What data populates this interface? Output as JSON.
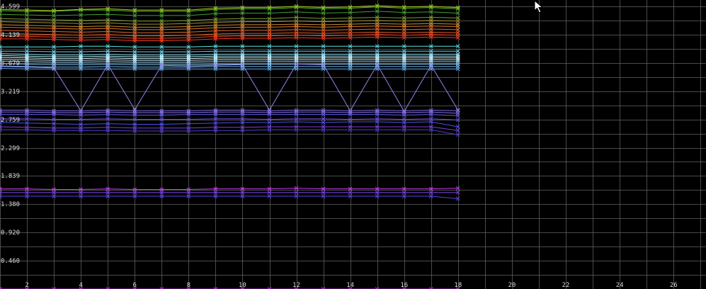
{
  "chart_data": {
    "type": "line",
    "title": "",
    "xlabel": "",
    "ylabel": "",
    "xlim": [
      1,
      27.1
    ],
    "ylim": [
      0,
      4.599
    ],
    "grid": true,
    "legend": "none",
    "background": "#000000",
    "grid_color": "#6a6a6a",
    "x_ticks": [
      2,
      4,
      6,
      8,
      10,
      12,
      14,
      16,
      18,
      20,
      22,
      24,
      26
    ],
    "x_tick_labels": [
      "2",
      "4",
      "6",
      "8",
      "10",
      "12",
      "14",
      "16",
      "18",
      "20",
      "22",
      "24",
      "26"
    ],
    "y_ticks": [
      0.46,
      0.92,
      1.38,
      1.839,
      2.299,
      2.759,
      3.219,
      3.679,
      4.139,
      4.599
    ],
    "y_tick_labels": [
      "0.460",
      "0.920",
      "1.380",
      "1.839",
      "2.299",
      "2.759",
      "3.219",
      "3.679",
      "4.139",
      "4.599"
    ],
    "x": [
      1,
      2,
      3,
      4,
      5,
      6,
      7,
      8,
      9,
      10,
      11,
      12,
      13,
      14,
      15,
      16,
      17,
      18
    ],
    "series": [
      {
        "color": "#a0c820",
        "values": [
          4.55,
          4.54,
          4.53,
          4.55,
          4.56,
          4.54,
          4.54,
          4.54,
          4.57,
          4.58,
          4.58,
          4.6,
          4.58,
          4.59,
          4.61,
          4.59,
          4.6,
          4.58
        ]
      },
      {
        "color": "#6ab820",
        "values": [
          4.53,
          4.52,
          4.52,
          4.54,
          4.54,
          4.52,
          4.52,
          4.52,
          4.55,
          4.56,
          4.56,
          4.58,
          4.56,
          4.57,
          4.59,
          4.57,
          4.58,
          4.56
        ]
      },
      {
        "color": "#40a030",
        "values": [
          4.47,
          4.46,
          4.45,
          4.46,
          4.47,
          4.45,
          4.45,
          4.45,
          4.48,
          4.49,
          4.49,
          4.51,
          4.49,
          4.5,
          4.52,
          4.5,
          4.51,
          4.49
        ]
      },
      {
        "color": "#7a9a30",
        "values": [
          4.4,
          4.39,
          4.38,
          4.37,
          4.38,
          4.36,
          4.36,
          4.37,
          4.39,
          4.4,
          4.4,
          4.42,
          4.4,
          4.41,
          4.42,
          4.41,
          4.42,
          4.41
        ]
      },
      {
        "color": "#a09030",
        "values": [
          4.35,
          4.34,
          4.33,
          4.32,
          4.33,
          4.31,
          4.31,
          4.32,
          4.34,
          4.35,
          4.35,
          4.36,
          4.35,
          4.36,
          4.37,
          4.36,
          4.37,
          4.36
        ]
      },
      {
        "color": "#c88a30",
        "values": [
          4.3,
          4.29,
          4.28,
          4.27,
          4.28,
          4.26,
          4.26,
          4.27,
          4.29,
          4.3,
          4.3,
          4.31,
          4.3,
          4.31,
          4.32,
          4.31,
          4.32,
          4.31
        ]
      },
      {
        "color": "#d87a30",
        "values": [
          4.26,
          4.25,
          4.24,
          4.23,
          4.24,
          4.22,
          4.22,
          4.23,
          4.25,
          4.26,
          4.26,
          4.27,
          4.26,
          4.27,
          4.28,
          4.27,
          4.28,
          4.27
        ]
      },
      {
        "color": "#e06a30",
        "values": [
          4.21,
          4.2,
          4.19,
          4.18,
          4.19,
          4.17,
          4.17,
          4.18,
          4.2,
          4.21,
          4.21,
          4.22,
          4.21,
          4.22,
          4.23,
          4.22,
          4.23,
          4.22
        ]
      },
      {
        "color": "#e85a28",
        "values": [
          4.16,
          4.15,
          4.14,
          4.13,
          4.14,
          4.12,
          4.12,
          4.13,
          4.15,
          4.16,
          4.16,
          4.17,
          4.16,
          4.17,
          4.18,
          4.17,
          4.18,
          4.17
        ]
      },
      {
        "color": "#ee4422",
        "values": [
          4.12,
          4.11,
          4.1,
          4.09,
          4.1,
          4.08,
          4.08,
          4.09,
          4.11,
          4.12,
          4.12,
          4.13,
          4.12,
          4.13,
          4.14,
          4.13,
          4.14,
          4.13
        ]
      },
      {
        "color": "#f03a20",
        "values": [
          4.07,
          4.07,
          4.06,
          4.05,
          4.06,
          4.04,
          4.04,
          4.05,
          4.07,
          4.08,
          4.08,
          4.09,
          4.08,
          4.09,
          4.1,
          4.09,
          4.1,
          4.09
        ]
      },
      {
        "color": "#5ee0e0",
        "values": [
          3.94,
          3.94,
          3.94,
          3.95,
          3.95,
          3.94,
          3.94,
          3.94,
          3.95,
          3.95,
          3.95,
          3.95,
          3.95,
          3.95,
          3.95,
          3.95,
          3.95,
          3.95
        ]
      },
      {
        "color": "#70d0f0",
        "values": [
          3.87,
          3.87,
          3.86,
          3.86,
          3.87,
          3.86,
          3.86,
          3.86,
          3.87,
          3.87,
          3.87,
          3.87,
          3.87,
          3.87,
          3.87,
          3.87,
          3.87,
          3.87
        ]
      },
      {
        "color": "#90e8ff",
        "values": [
          3.83,
          3.82,
          3.81,
          3.81,
          3.82,
          3.81,
          3.81,
          3.81,
          3.82,
          3.82,
          3.82,
          3.82,
          3.82,
          3.82,
          3.82,
          3.82,
          3.82,
          3.82
        ]
      },
      {
        "color": "#b0f0ff",
        "values": [
          3.8,
          3.79,
          3.78,
          3.78,
          3.79,
          3.78,
          3.78,
          3.78,
          3.79,
          3.79,
          3.79,
          3.79,
          3.79,
          3.79,
          3.79,
          3.79,
          3.79,
          3.79
        ]
      },
      {
        "color": "#e0ffff",
        "values": [
          3.77,
          3.76,
          3.75,
          3.75,
          3.76,
          3.75,
          3.75,
          3.75,
          3.76,
          3.76,
          3.76,
          3.76,
          3.76,
          3.76,
          3.76,
          3.76,
          3.76,
          3.76
        ]
      },
      {
        "color": "#c0e8ff",
        "values": [
          3.74,
          3.73,
          3.72,
          3.72,
          3.73,
          3.72,
          3.72,
          3.72,
          3.73,
          3.73,
          3.73,
          3.73,
          3.73,
          3.73,
          3.73,
          3.73,
          3.73,
          3.73
        ]
      },
      {
        "color": "#a0d8f8",
        "values": [
          3.71,
          3.7,
          3.69,
          3.69,
          3.7,
          3.69,
          3.69,
          3.69,
          3.7,
          3.7,
          3.7,
          3.7,
          3.7,
          3.7,
          3.7,
          3.7,
          3.7,
          3.7
        ]
      },
      {
        "color": "#88c8f0",
        "values": [
          3.67,
          3.66,
          3.65,
          3.65,
          3.66,
          3.65,
          3.65,
          3.65,
          3.66,
          3.66,
          3.66,
          3.66,
          3.66,
          3.66,
          3.66,
          3.66,
          3.66,
          3.66
        ]
      },
      {
        "color": "#70b8ec",
        "values": [
          3.63,
          3.62,
          3.61,
          3.61,
          3.62,
          3.61,
          3.61,
          3.61,
          3.62,
          3.62,
          3.62,
          3.62,
          3.62,
          3.62,
          3.62,
          3.62,
          3.62,
          3.62
        ]
      },
      {
        "color": "#60a8e8",
        "values": [
          3.59,
          3.58,
          3.58,
          3.58,
          3.58,
          3.58,
          3.58,
          3.58,
          3.58,
          3.58,
          3.58,
          3.58,
          3.58,
          3.58,
          3.58,
          3.58,
          3.58,
          3.58
        ]
      },
      {
        "color": "#9a80e8",
        "values": [
          3.62,
          3.61,
          3.6,
          2.9,
          3.65,
          2.92,
          3.64,
          3.63,
          3.64,
          3.65,
          2.91,
          3.66,
          3.65,
          2.9,
          3.65,
          2.89,
          3.64,
          2.91
        ]
      },
      {
        "color": "#7a70e0",
        "values": [
          2.91,
          2.91,
          2.9,
          2.9,
          2.91,
          2.9,
          2.9,
          2.9,
          2.91,
          2.91,
          2.9,
          2.91,
          2.91,
          2.9,
          2.91,
          2.9,
          2.91,
          2.9
        ]
      },
      {
        "color": "#8a6ae8",
        "values": [
          2.88,
          2.88,
          2.87,
          2.87,
          2.88,
          2.87,
          2.87,
          2.87,
          2.88,
          2.88,
          2.87,
          2.88,
          2.88,
          2.87,
          2.88,
          2.87,
          2.88,
          2.86
        ]
      },
      {
        "color": "#5a60e0",
        "values": [
          2.84,
          2.84,
          2.84,
          2.83,
          2.84,
          2.83,
          2.83,
          2.84,
          2.84,
          2.84,
          2.84,
          2.84,
          2.84,
          2.84,
          2.84,
          2.83,
          2.84,
          2.82
        ]
      },
      {
        "color": "#6a50e0",
        "values": [
          2.77,
          2.77,
          2.76,
          2.76,
          2.77,
          2.76,
          2.76,
          2.76,
          2.77,
          2.77,
          2.76,
          2.77,
          2.77,
          2.76,
          2.77,
          2.76,
          2.77,
          2.75
        ]
      },
      {
        "color": "#4a50e8",
        "values": [
          2.71,
          2.7,
          2.69,
          2.68,
          2.69,
          2.68,
          2.68,
          2.69,
          2.7,
          2.71,
          2.71,
          2.72,
          2.71,
          2.72,
          2.72,
          2.71,
          2.72,
          2.64
        ]
      },
      {
        "color": "#7a40d8",
        "values": [
          2.64,
          2.63,
          2.62,
          2.62,
          2.63,
          2.62,
          2.62,
          2.62,
          2.63,
          2.63,
          2.64,
          2.64,
          2.64,
          2.64,
          2.64,
          2.64,
          2.64,
          2.58
        ]
      },
      {
        "color": "#4a40d0",
        "values": [
          2.59,
          2.59,
          2.58,
          2.58,
          2.58,
          2.57,
          2.57,
          2.57,
          2.58,
          2.58,
          2.59,
          2.59,
          2.59,
          2.59,
          2.59,
          2.59,
          2.59,
          2.51
        ]
      },
      {
        "color": "#c040e8",
        "values": [
          1.63,
          1.63,
          1.62,
          1.62,
          1.63,
          1.62,
          1.62,
          1.62,
          1.63,
          1.63,
          1.63,
          1.64,
          1.63,
          1.63,
          1.63,
          1.63,
          1.63,
          1.64
        ]
      },
      {
        "color": "#8040e8",
        "values": [
          1.57,
          1.57,
          1.57,
          1.57,
          1.57,
          1.57,
          1.57,
          1.57,
          1.57,
          1.57,
          1.57,
          1.57,
          1.57,
          1.57,
          1.57,
          1.57,
          1.57,
          1.57
        ]
      },
      {
        "color": "#5a40e8",
        "values": [
          1.51,
          1.51,
          1.51,
          1.51,
          1.51,
          1.51,
          1.51,
          1.51,
          1.51,
          1.51,
          1.51,
          1.51,
          1.51,
          1.51,
          1.51,
          1.51,
          1.51,
          1.47
        ]
      },
      {
        "color": "#c030e0",
        "values": [
          0.0,
          0.0,
          0.0,
          0.0,
          0.0,
          0.0,
          0.0,
          0.0,
          0.0,
          0.0,
          0.0,
          0.0,
          0.0,
          0.0,
          0.0,
          0.0,
          0.0,
          0.0
        ]
      }
    ]
  },
  "icons": {
    "cursor": "mouse-pointer-icon"
  }
}
